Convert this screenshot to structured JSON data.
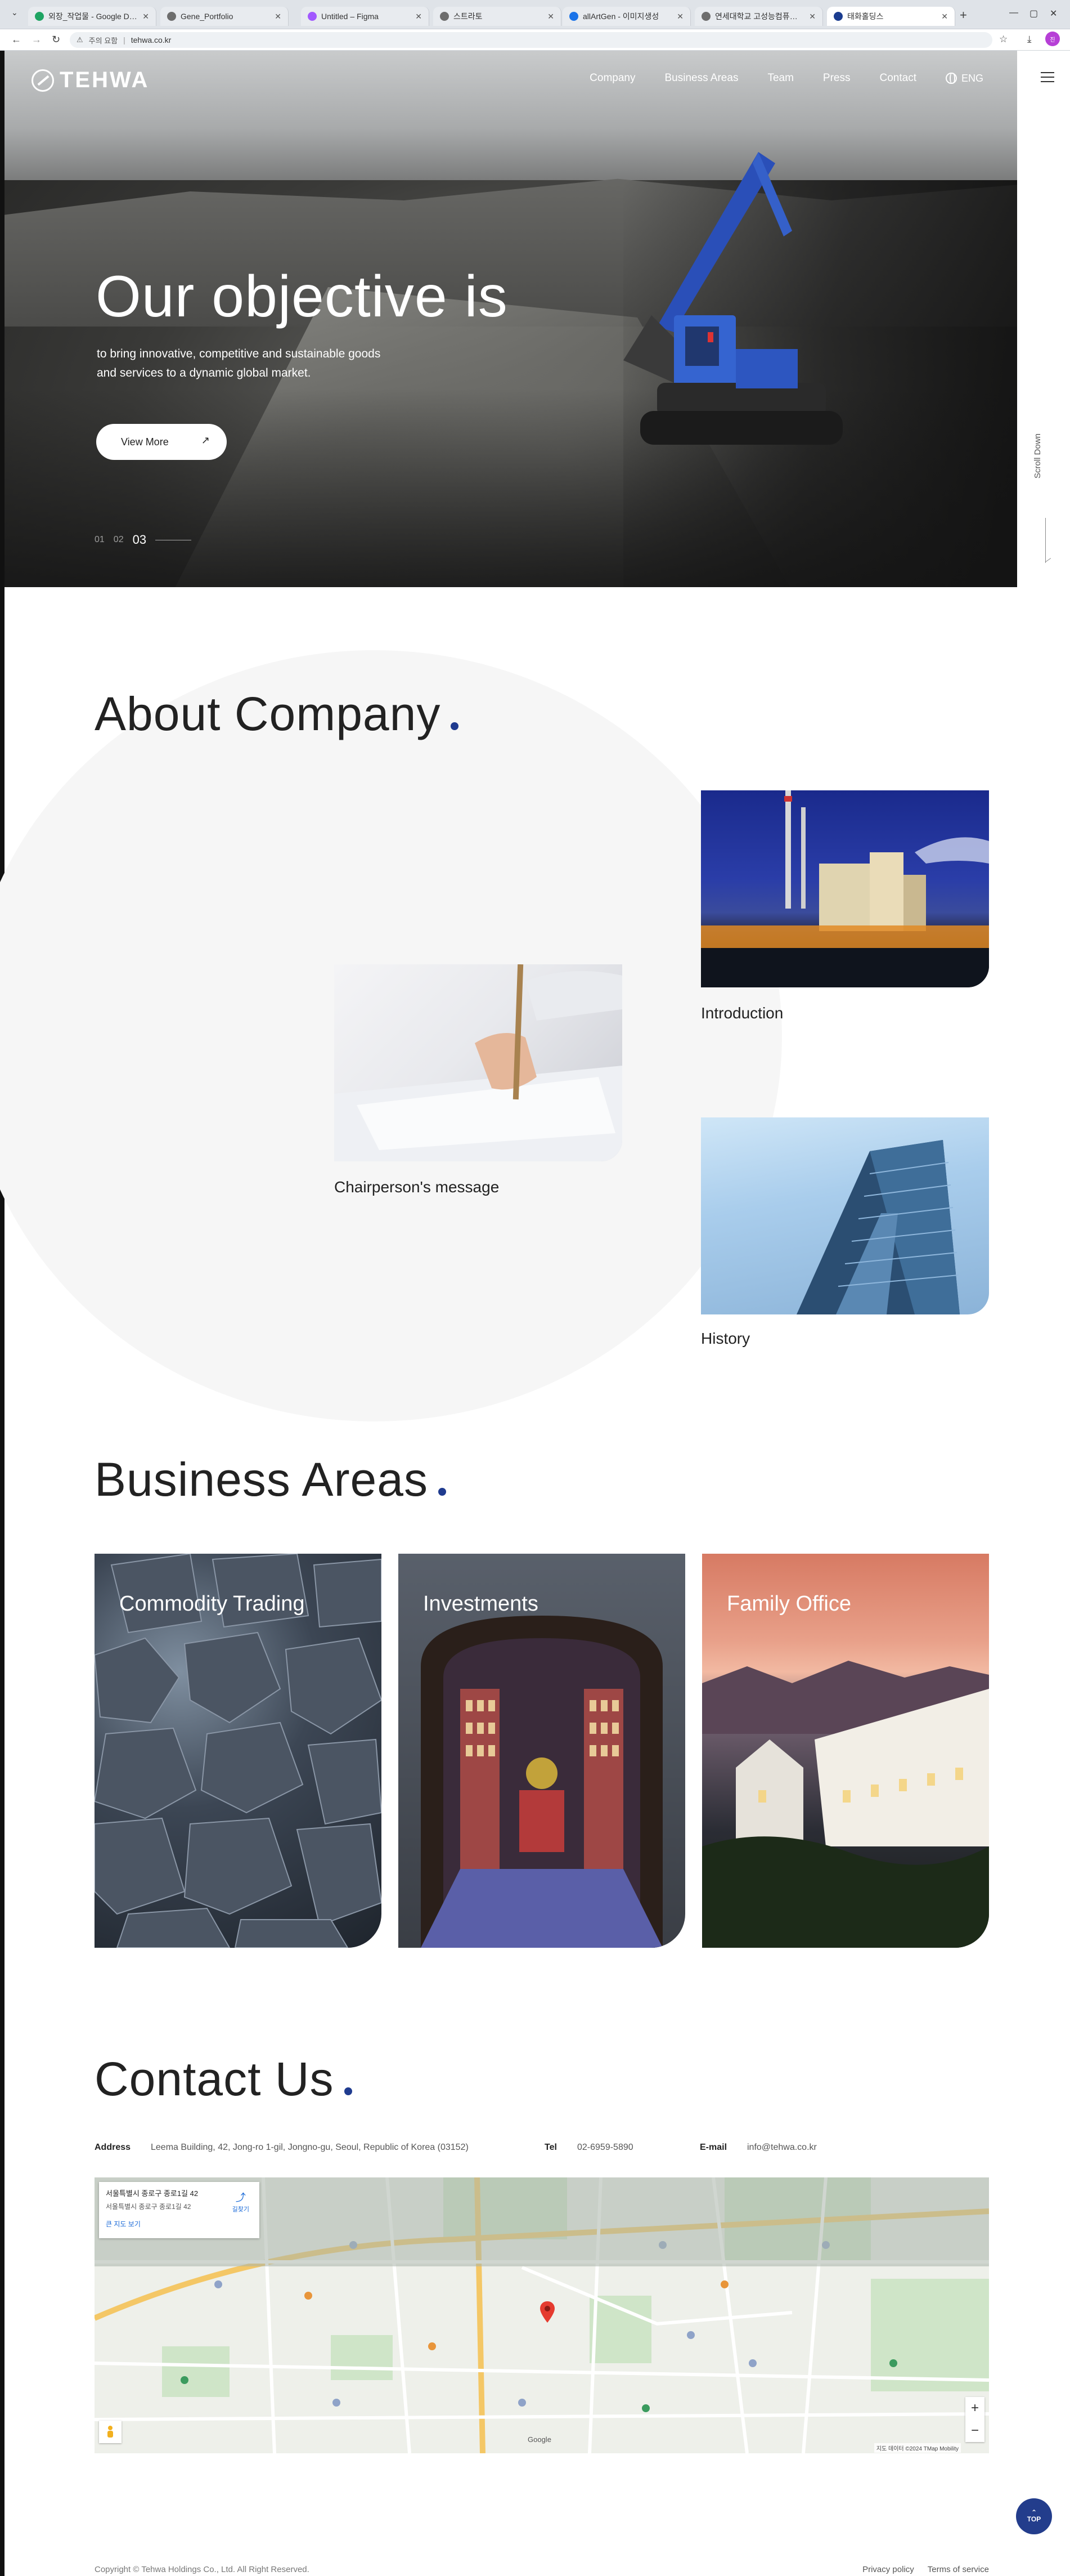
{
  "browser": {
    "tabs": [
      {
        "label": "외장_작업물 - Google Drive",
        "color": "#1fa463"
      },
      {
        "label": "Gene_Portfolio",
        "color": "#6d6d6d"
      },
      {
        "label": "Untitled – Figma",
        "color": "#a259ff"
      },
      {
        "label": "스트라토",
        "color": "#6d6d6d"
      },
      {
        "label": "allArtGen - 이미지생성",
        "color": "#1a73e8"
      },
      {
        "label": "연세대학교 고성능컴퓨팅센터",
        "color": "#6d6d6d"
      },
      {
        "label": "태화홀딩스",
        "color": "#1a3c8f"
      }
    ],
    "active_tab_index": 6,
    "address_warning": "주의 요함",
    "url": "tehwa.co.kr",
    "profile_initials": "진"
  },
  "nav": {
    "logo": "TEHWA",
    "links": [
      "Company",
      "Business Areas",
      "Team",
      "Press",
      "Contact"
    ],
    "lang": "ENG"
  },
  "hero": {
    "title": "Our objective is",
    "subtitle_line1": "to bring innovative, competitive and sustainable goods",
    "subtitle_line2": "and services to a dynamic global market.",
    "cta": "View More",
    "cta_arrow": "↗",
    "pager": [
      "01",
      "02",
      "03"
    ],
    "pager_current": "03",
    "scroll_hint": "Scroll Down"
  },
  "about": {
    "title": "About Company",
    "cards": {
      "introduction": "Introduction",
      "chairperson": "Chairperson's message",
      "history": "History"
    }
  },
  "business": {
    "title": "Business Areas",
    "cards": [
      "Commodity Trading",
      "Investments",
      "Family Office"
    ]
  },
  "contact": {
    "title": "Contact Us",
    "address_label": "Address",
    "address": "Leema Building, 42, Jong-ro 1-gil, Jongno-gu, Seoul, Republic of Korea (03152)",
    "tel_label": "Tel",
    "tel": "02-6959-5890",
    "email_label": "E-mail",
    "email": "info@tehwa.co.kr",
    "map": {
      "place_title": "서울특별시 종로구 종로1길 42",
      "place_sub": "서울특별시 종로구 종로1길 42",
      "larger_map": "큰 지도 보기",
      "directions": "길찾기",
      "zoom_in": "+",
      "zoom_out": "−",
      "terms": "지도 데이터 ©2024 TMap Mobility",
      "google": "Google"
    }
  },
  "footer": {
    "copyright": "Copyright © Tehwa Holdings Co., Ltd. All Right Reserved.",
    "privacy": "Privacy policy",
    "terms": "Terms of service",
    "top": "TOP"
  },
  "colors": {
    "accent_dot": "#1f3b8f",
    "top_button": "#233d8c"
  }
}
